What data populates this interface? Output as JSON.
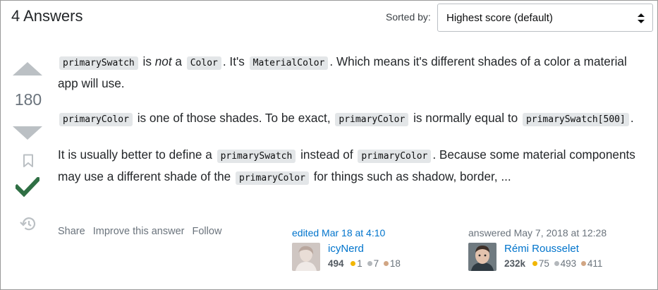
{
  "header": {
    "answers_count": "4 Answers",
    "sort_label": "Sorted by:",
    "sort_value": "Highest score (default)"
  },
  "votes": {
    "score": "180"
  },
  "post": {
    "p1": {
      "code1": "primarySwatch",
      "t1": " is ",
      "em1": "not",
      "t2": " a ",
      "code2": "Color",
      "t3": ". It's ",
      "code3": "MaterialColor",
      "t4": ". Which means it's different shades of a color a material app will use."
    },
    "p2": {
      "code1": "primaryColor",
      "t1": " is one of those shades. To be exact, ",
      "code2": "primaryColor",
      "t2": " is normally equal to ",
      "code3": "primarySwatch[500]",
      "t3": "."
    },
    "p3": {
      "t1": "It is usually better to define a ",
      "code1": "primarySwatch",
      "t2": " instead of ",
      "code2": "primaryColor",
      "t3": ". Because some material components may use a different shade of the ",
      "code3": "primaryColor",
      "t4": " for things such as shadow, border, ..."
    }
  },
  "post_menu": {
    "share": "Share",
    "improve": "Improve this answer",
    "follow": "Follow"
  },
  "editor": {
    "action": "edited Mar 18 at 4:10",
    "name": "icyNerd",
    "rep": "494",
    "gold": "1",
    "silver": "7",
    "bronze": "18"
  },
  "author": {
    "action": "answered May 7, 2018 at 12:28",
    "name": "Rémi Rousselet",
    "rep": "232k",
    "gold": "75",
    "silver": "493",
    "bronze": "411"
  },
  "icons": {
    "sort": "sort-arrows-icon",
    "up": "vote-up-icon",
    "down": "vote-down-icon",
    "bookmark": "bookmark-icon",
    "accepted": "checkmark-icon",
    "history": "history-icon"
  },
  "colors": {
    "accepted": "#2f6f44",
    "link": "#0074cc",
    "vote_arrow": "#bbc0c4",
    "code_bg": "#e3e6e8"
  }
}
